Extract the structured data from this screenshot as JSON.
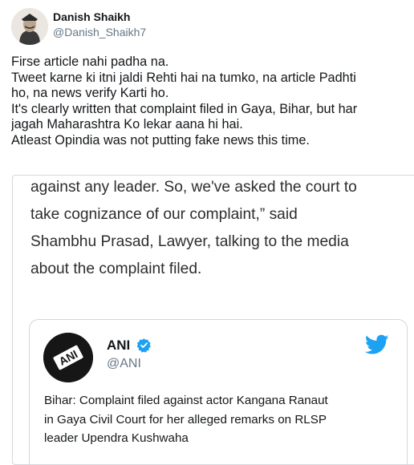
{
  "tweet": {
    "display_name": "Danish Shaikh",
    "handle": "@Danish_Shaikh7",
    "text_lines": [
      "Firse article nahi padha na.",
      "Tweet karne ki itni jaldi Rehti hai na tumko, na article Padhti",
      "ho, na news verify Karti ho.",
      "It's clearly written that complaint filed in Gaya, Bihar, but har",
      "jagah Maharashtra Ko lekar aana hi hai.",
      "Atleast Opindia was not putting fake news this time."
    ]
  },
  "article": {
    "lines": [
      "against any leader. So, we've asked the court to",
      "take cognizance of our complaint,” said",
      "Shambhu Prasad, Lawyer, talking to the media",
      "about the complaint filed."
    ]
  },
  "embedded_tweet": {
    "logo_text": "ANI",
    "name": "ANI",
    "handle": "@ANI",
    "text_lines": [
      "Bihar: Complaint filed against actor Kangana Ranaut",
      "in Gaya Civil Court for her alleged remarks on RLSP",
      "leader Upendra Kushwaha"
    ]
  },
  "colors": {
    "verified": "#1da1f2",
    "twitter_brand": "#1da1f2",
    "handle_gray": "#657786"
  }
}
